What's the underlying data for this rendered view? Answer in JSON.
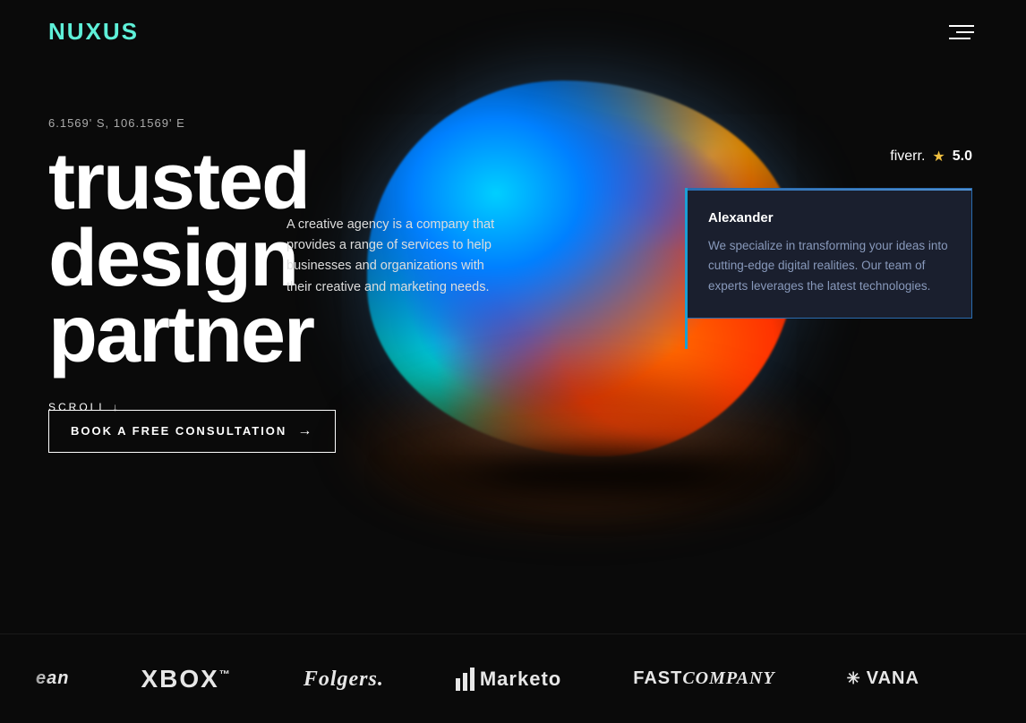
{
  "header": {
    "logo": "NUXUS"
  },
  "hero": {
    "coordinates": "6.1569' S, 106.1569' E",
    "title_line1": "trusted",
    "title_line2": "design",
    "title_line3": "partner",
    "description": "A creative agency is a company that provides a range of services to help businesses and organizations with their creative and marketing needs.",
    "cta_label": "BOOK A FREE CONSULTATION",
    "scroll_label": "SCROLL ↓"
  },
  "fiverr": {
    "brand": "fiverr.",
    "rating": "5.0"
  },
  "testimonial": {
    "name": "Alexander",
    "text": "We specialize in transforming your ideas into cutting-edge digital realities. Our team of experts leverages the latest technologies."
  },
  "logos": [
    {
      "name": "lean",
      "label": "ean",
      "type": "lean"
    },
    {
      "name": "xbox",
      "label": "XBOX™",
      "type": "xbox"
    },
    {
      "name": "folgers",
      "label": "Folgers.",
      "type": "folgers"
    },
    {
      "name": "marketo",
      "label": "Marketo",
      "type": "marketo"
    },
    {
      "name": "fastcompany",
      "label": "FAST COMPANY",
      "type": "fastcompany"
    },
    {
      "name": "vana",
      "label": "VANA",
      "type": "vana"
    }
  ]
}
